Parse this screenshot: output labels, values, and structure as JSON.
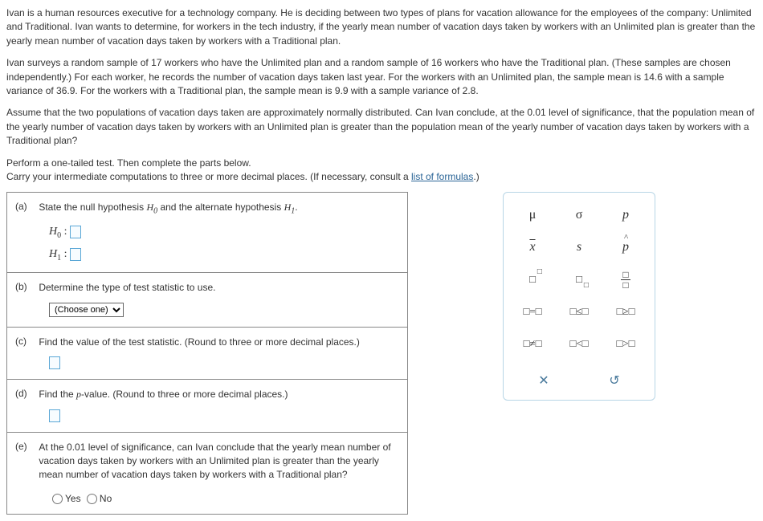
{
  "intro": {
    "p1": "Ivan is a human resources executive for a technology company. He is deciding between two types of plans for vacation allowance for the employees of the company: Unlimited and Traditional. Ivan wants to determine, for workers in the tech industry, if the yearly mean number of vacation days taken by workers with an Unlimited plan is greater than the yearly mean number of vacation days taken by workers with a Traditional plan.",
    "p2_a": "Ivan surveys a random sample of ",
    "n1": "17",
    "p2_b": " workers who have the Unlimited plan and a random sample of ",
    "n2": "16",
    "p2_c": " workers who have the Traditional plan. (These samples are chosen independently.) For each worker, he records the number of vacation days taken last year. For the workers with an Unlimited plan, the sample mean is ",
    "m1": "14.6",
    "p2_d": " with a sample variance of ",
    "v1": "36.9",
    "p2_e": ". For the workers with a Traditional plan, the sample mean is ",
    "m2": "9.9",
    "p2_f": " with a sample variance of ",
    "v2": "2.8",
    "p2_g": ".",
    "p3_a": "Assume that the two populations of vacation days taken are approximately normally distributed. Can Ivan conclude, at the ",
    "alpha": "0.01",
    "p3_b": " level of significance, that the population mean of the yearly number of vacation days taken by workers with an Unlimited plan is greater than the population mean of the yearly number of vacation days taken by workers with a Traditional plan?",
    "p4_a": "Perform a one-tailed test. Then complete the parts below.",
    "p4_b": "Carry your intermediate computations to three or more decimal places. (If necessary, consult a ",
    "link": "list of formulas",
    "p4_c": ".)"
  },
  "parts": {
    "a": {
      "label": "(a)",
      "text_a": "State the null hypothesis ",
      "h0sym": "H",
      "h0sub": "0",
      "text_b": " and the alternate hypothesis ",
      "h1sym": "H",
      "h1sub": "1",
      "text_c": ".",
      "h0line": "H",
      "h0colon": " :",
      "h1line": "H",
      "h1colon": " :"
    },
    "b": {
      "label": "(b)",
      "text": "Determine the type of test statistic to use.",
      "select": "(Choose one)"
    },
    "c": {
      "label": "(c)",
      "text": "Find the value of the test statistic. (Round to three or more decimal places.)"
    },
    "d": {
      "label": "(d)",
      "text_a": "Find the ",
      "pval": "p",
      "text_b": "-value. (Round to three or more decimal places.)"
    },
    "e": {
      "label": "(e)",
      "text": "At the 0.01 level of significance, can Ivan conclude that the yearly mean number of vacation days taken by workers with an Unlimited plan is greater than the yearly mean number of vacation days taken by workers with a Traditional plan?",
      "yes": "Yes",
      "no": "No"
    }
  },
  "palette": {
    "mu": "μ",
    "sigma": "σ",
    "p": "p",
    "xbar": "x",
    "s": "s",
    "phat": "p",
    "eq": "=",
    "le": "≤",
    "ge": "≥",
    "ne": "≠",
    "lt": "<",
    "gt": ">",
    "close": "✕",
    "reset": "↺"
  }
}
